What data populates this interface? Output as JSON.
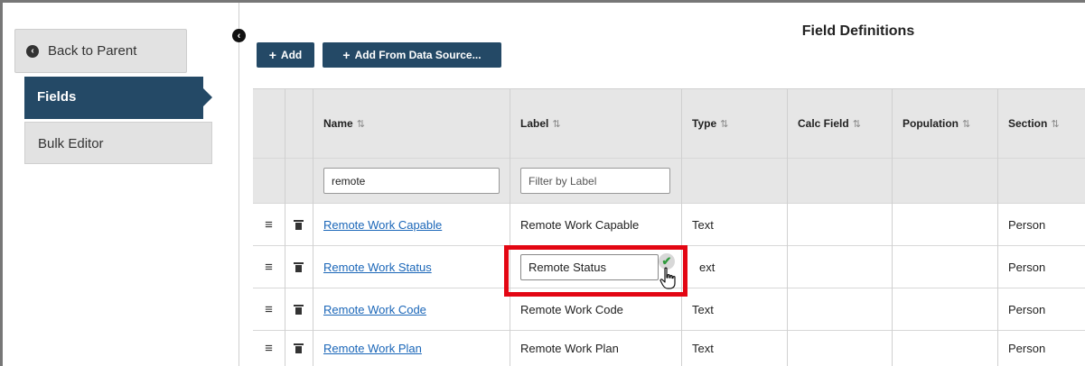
{
  "sidebar": {
    "back_label": "Back to Parent",
    "items": [
      {
        "label": "Fields",
        "active": true
      },
      {
        "label": "Bulk Editor",
        "active": false
      }
    ]
  },
  "header": {
    "title": "Field Definitions",
    "add_label": "Add",
    "add_from_ds_label": "Add From Data Source..."
  },
  "table": {
    "columns": [
      {
        "key": "name",
        "label": "Name",
        "sort": "⇅"
      },
      {
        "key": "label",
        "label": "Label",
        "sort": "⇅"
      },
      {
        "key": "type",
        "label": "Type",
        "sort": "⇅"
      },
      {
        "key": "calc",
        "label": "Calc Field",
        "sort": "⇅"
      },
      {
        "key": "population",
        "label": "Population",
        "sort": "⇅"
      },
      {
        "key": "section",
        "label": "Section",
        "sort": "⇅"
      }
    ],
    "filters": {
      "name_value": "remote",
      "label_placeholder": "Filter by Label"
    },
    "rows": [
      {
        "name": "Remote Work Capable",
        "label": "Remote Work Capable",
        "type": "Text",
        "calc": "",
        "population": "",
        "section": "Person"
      },
      {
        "name": "Remote Work Status",
        "label": "Remote Status",
        "type": "ext",
        "calc": "",
        "population": "",
        "section": "Person",
        "editing": true
      },
      {
        "name": "Remote Work Code",
        "label": "Remote Work Code",
        "type": "Text",
        "calc": "",
        "population": "",
        "section": "Person"
      },
      {
        "name": "Remote Work Plan",
        "label": "Remote Work Plan",
        "type": "Text",
        "calc": "",
        "population": "",
        "section": "Person"
      }
    ]
  },
  "colors": {
    "primary": "#244966",
    "highlight": "#e30613",
    "link": "#1a66b8",
    "confirm": "#2e9a3c"
  },
  "icons": {
    "back": "circle-chevron-left-icon",
    "collapse": "circle-chevron-left-icon",
    "handle": "hamburger-icon",
    "delete": "trash-icon",
    "confirm": "checkmark-icon",
    "cursor": "hand-pointer-icon"
  }
}
